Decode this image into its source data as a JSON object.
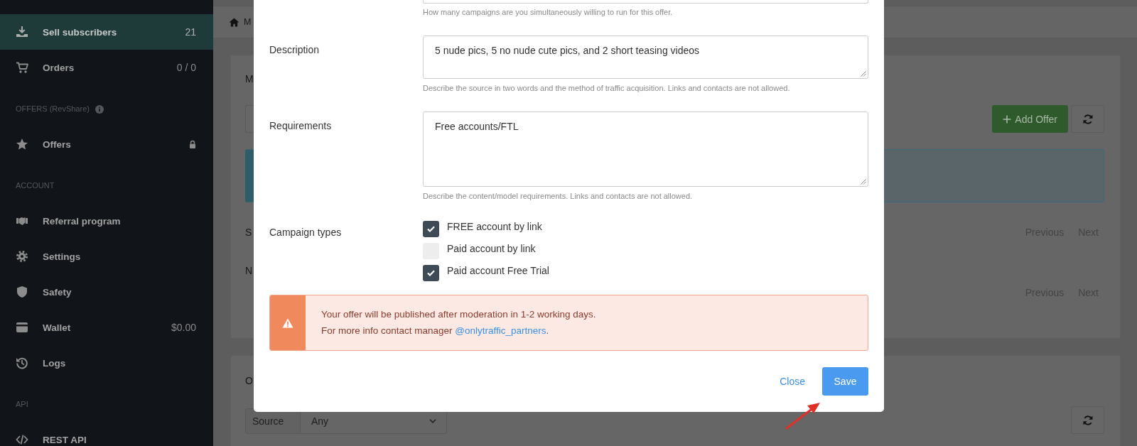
{
  "sidebar": {
    "sections": [
      {
        "items": [
          {
            "label": "Sell subscribers",
            "count": "21",
            "selected": true,
            "locked": false
          },
          {
            "label": "Orders",
            "count": "0 / 0",
            "selected": false,
            "locked": false
          }
        ]
      },
      {
        "header": "OFFERS (RevShare)",
        "hint": true,
        "items": [
          {
            "label": "Offers",
            "selected": false,
            "locked": true
          }
        ]
      },
      {
        "header": "ACCOUNT",
        "hint": false,
        "items": [
          {
            "label": "Referral program",
            "selected": false,
            "locked": false
          },
          {
            "label": "Settings",
            "selected": false,
            "locked": false
          },
          {
            "label": "Safety",
            "selected": false,
            "locked": false
          },
          {
            "label": "Wallet",
            "count": "$0.00",
            "selected": false,
            "locked": false
          },
          {
            "label": "Logs",
            "selected": false,
            "locked": false
          }
        ]
      },
      {
        "header": "API",
        "hint": false,
        "items": [
          {
            "label": "REST API",
            "selected": false,
            "locked": false
          }
        ]
      }
    ]
  },
  "breadcrumb": {
    "text": "M"
  },
  "offers_card": {
    "title": "M",
    "add_button": "Add Offer",
    "rows": [
      {
        "text": "S",
        "pager": [
          "Previous",
          "Next"
        ]
      },
      {
        "text": "N",
        "pager": [
          "Previous",
          "Next"
        ]
      }
    ]
  },
  "second_card": {
    "title": "O",
    "filter": {
      "label": "Source",
      "value": "Any"
    }
  },
  "modal": {
    "partial_field_help": "How many campaigns are you simultaneously willing to run for this offer.",
    "fields": [
      {
        "label": "Description",
        "value": "5 nude pics, 5 no nude cute pics, and 2 short teasing videos",
        "help": "Describe the source in two words and the method of traffic acquisition. Links and contacts are not allowed."
      },
      {
        "label": "Requirements",
        "value": "Free accounts/FTL",
        "help": "Describe the content/model requirements. Links and contacts are not allowed."
      }
    ],
    "campaign_types": {
      "label": "Campaign types",
      "options": [
        {
          "label": "FREE account by link",
          "checked": true
        },
        {
          "label": "Paid account by link",
          "checked": false
        },
        {
          "label": "Paid account Free Trial",
          "checked": true
        }
      ]
    },
    "alert": {
      "text": "Your offer will be published after moderation in 1-2 working days.",
      "contact_text": "For more info contact manager",
      "link": "@onlytraffic_partners",
      "contact_end": "."
    },
    "close_button": "Close",
    "save_button": "Save"
  }
}
